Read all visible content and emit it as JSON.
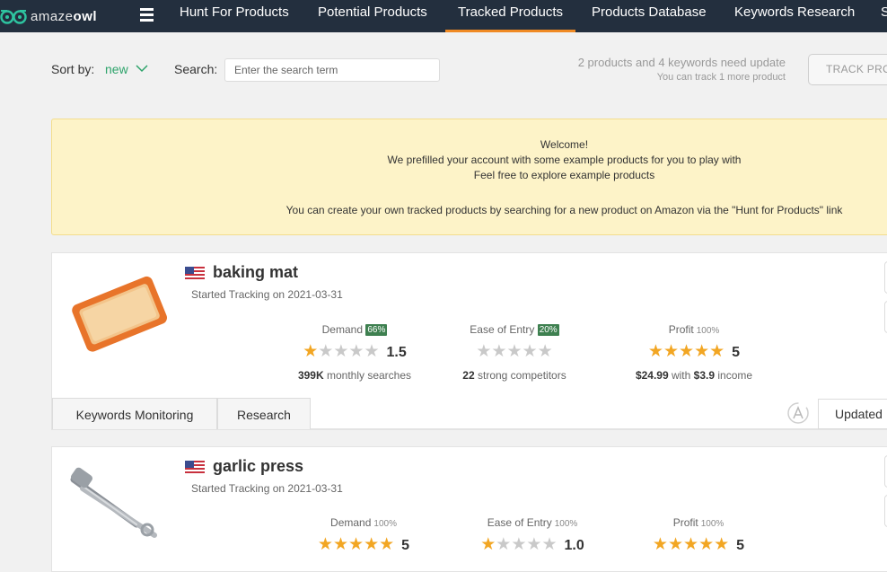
{
  "brand": {
    "name_light": "amaze",
    "name_bold": "owl"
  },
  "nav": {
    "items": [
      "Hunt For Products",
      "Potential Products",
      "Tracked Products",
      "Products Database",
      "Keywords Research",
      "S"
    ],
    "active_index": 2
  },
  "toolbar": {
    "sort_label": "Sort by:",
    "sort_value": "new",
    "search_label": "Search:",
    "search_placeholder": "Enter the search term",
    "update_main": "2 products and 4 keywords need update",
    "update_sub": "You can track 1 more product",
    "track_button": "TRACK PRODUCT"
  },
  "banner": {
    "line1": "Welcome!",
    "line2": "We prefilled your account with some example products for you to play with",
    "line3": "Feel free to explore example products",
    "line4": "You can create your own tracked products by searching for a new product on Amazon via the \"Hunt for Products\" link"
  },
  "products": [
    {
      "title": "baking mat",
      "started": "Started Tracking on 2021-03-31",
      "demand": {
        "label": "Demand",
        "pct": "66%",
        "stars": 1.5,
        "score": "1.5",
        "foot_bold": "399K",
        "foot_text": " monthly searches"
      },
      "ease": {
        "label": "Ease of Entry",
        "pct": "20%",
        "stars": 0,
        "score": "",
        "foot_bold": "22",
        "foot_text": " strong competitors"
      },
      "profit": {
        "label": "Profit",
        "pct": "100%",
        "stars": 5,
        "score": "5",
        "foot_bold": "$24.99",
        "foot_mid": " with ",
        "foot_bold2": "$3.9",
        "foot_text": " income"
      },
      "tabs": [
        "Keywords Monitoring",
        "Research"
      ],
      "updated": "Updated"
    },
    {
      "title": "garlic press",
      "started": "Started Tracking on 2021-03-31",
      "demand": {
        "label": "Demand",
        "pct": "100%",
        "stars": 5,
        "score": "5"
      },
      "ease": {
        "label": "Ease of Entry",
        "pct": "100%",
        "stars": 1,
        "score": "1.0"
      },
      "profit": {
        "label": "Profit",
        "pct": "100%",
        "stars": 5,
        "score": "5"
      }
    }
  ],
  "colors": {
    "nav_bg": "#232f3e",
    "active_underline": "#f08a24",
    "accent_green": "#2ea36b",
    "star": "#f2a623",
    "banner_bg": "#fdf3c8"
  }
}
